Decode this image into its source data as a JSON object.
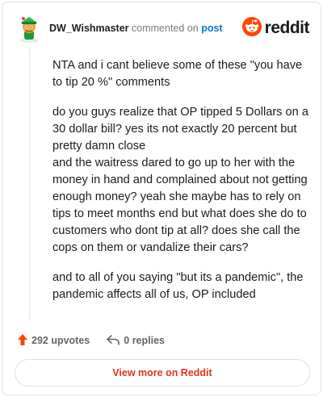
{
  "header": {
    "username": "DW_Wishmaster",
    "action_text": "commented on",
    "post_link": "post",
    "brand_wordmark": "reddit",
    "avatar_icon": "snoo-avatar-icon",
    "logo_icon": "reddit-snoo-icon"
  },
  "comment": {
    "paragraphs": [
      "NTA and i cant believe some of these \"you have to tip 20 %\" comments",
      "do you guys realize that OP tipped 5 Dollars on a 30 dollar bill? yes its not exactly 20 percent but pretty damn close",
      "and the waitress dared to go up to her with the money in hand and complained about not getting enough money? yeah she maybe has to rely on tips to meet months end but what does she do to customers who dont tip at all? does she call the cops on them or vandalize their cars?",
      "and to all of you saying \"but its a pandemic\", the pandemic affects all of us, OP included"
    ]
  },
  "actions": {
    "upvotes": "292 upvotes",
    "replies": "0 replies",
    "upvote_icon": "upvote-arrow-icon",
    "reply_icon": "reply-arrow-icon"
  },
  "footer": {
    "view_more": "View more on Reddit"
  },
  "colors": {
    "accent": "#ff4500",
    "link": "#0079d3",
    "button_text": "#e0341c"
  }
}
